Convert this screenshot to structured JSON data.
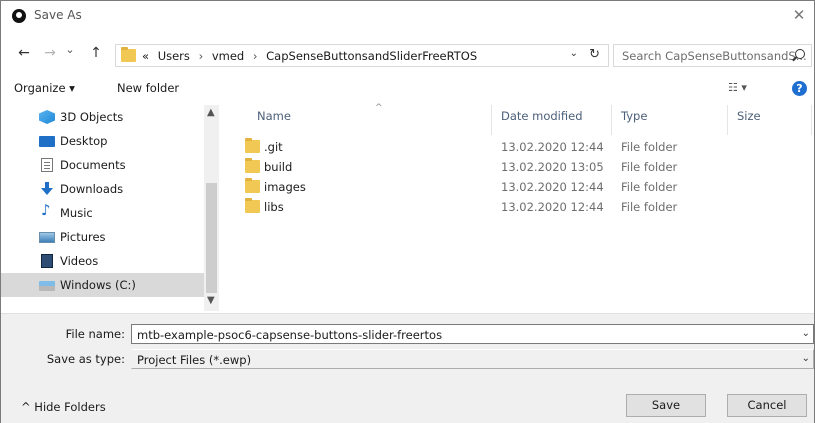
{
  "window": {
    "title": "Save As",
    "close_glyph": "✕"
  },
  "nav": {
    "back_glyph": "←",
    "forward_glyph": "→",
    "recent_glyph": "⌄",
    "up_glyph": "↑",
    "breadcrumb": [
      "«",
      "Users",
      "vmed",
      "CapSenseButtonsandSliderFreeRTOS"
    ],
    "separator": "›",
    "dropdown_glyph": "⌄",
    "refresh_glyph": "↻",
    "search_placeholder": "Search CapSenseButtonsandS..."
  },
  "toolbar": {
    "organize_label": "Organize ▾",
    "new_folder_label": "New folder",
    "view_glyph": "☷ ▾",
    "help_glyph": "?"
  },
  "sidebar": {
    "items": [
      {
        "label": "3D Objects",
        "icon": "3d-objects-icon"
      },
      {
        "label": "Desktop",
        "icon": "desktop-icon"
      },
      {
        "label": "Documents",
        "icon": "documents-icon"
      },
      {
        "label": "Downloads",
        "icon": "downloads-icon"
      },
      {
        "label": "Music",
        "icon": "music-icon"
      },
      {
        "label": "Pictures",
        "icon": "pictures-icon"
      },
      {
        "label": "Videos",
        "icon": "videos-icon"
      },
      {
        "label": "Windows (C:)",
        "icon": "drive-icon",
        "selected": true
      }
    ],
    "music_glyph": "♪"
  },
  "file_list": {
    "columns": [
      "Name",
      "Date modified",
      "Type",
      "Size"
    ],
    "sort_glyph": "^",
    "rows": [
      {
        "name": ".git",
        "date": "13.02.2020 12:44",
        "type": "File folder"
      },
      {
        "name": "build",
        "date": "13.02.2020 13:05",
        "type": "File folder"
      },
      {
        "name": "images",
        "date": "13.02.2020 12:44",
        "type": "File folder"
      },
      {
        "name": "libs",
        "date": "13.02.2020 12:44",
        "type": "File folder"
      }
    ]
  },
  "form": {
    "file_name_label": "File name:",
    "file_name_value": "mtb-example-psoc6-capsense-buttons-slider-freertos",
    "save_type_label": "Save as type:",
    "save_type_value": "Project Files (*.ewp)",
    "dropdown_glyph": "⌄"
  },
  "footer": {
    "hide_folders_label": "^  Hide Folders",
    "save_label": "Save",
    "cancel_label": "Cancel"
  },
  "colors": {
    "accent": "#1f6fd1",
    "folder": "#f2c855",
    "selected_bg": "#d9d9d9"
  }
}
